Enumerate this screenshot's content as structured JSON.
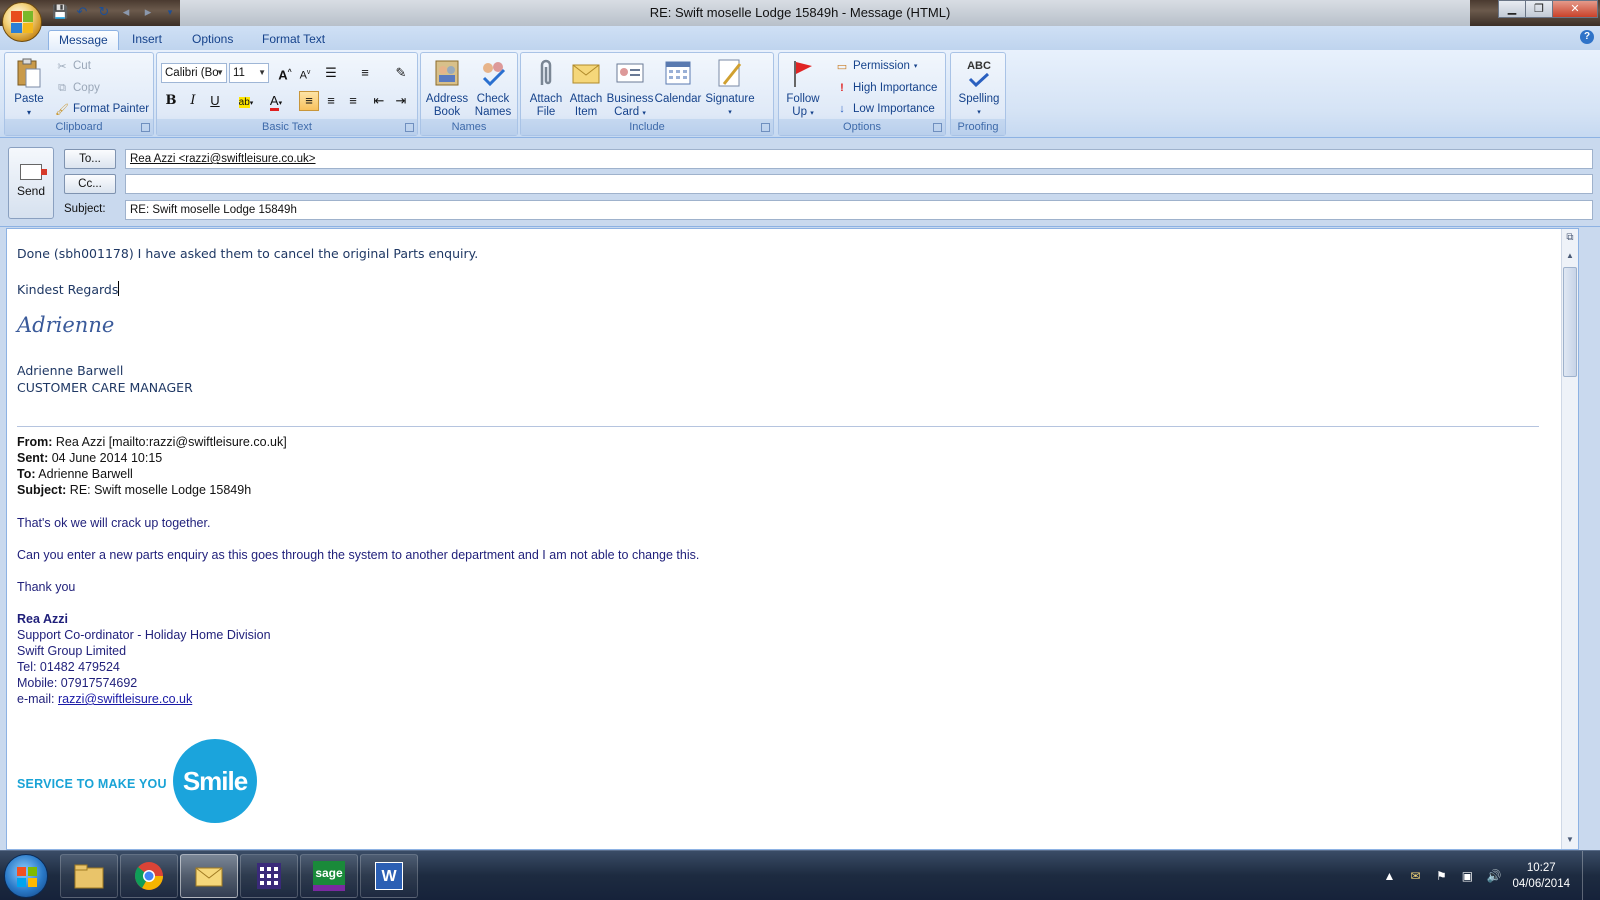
{
  "window": {
    "title": "RE: Swift moselle Lodge 15849h - Message (HTML)",
    "minimize": "▁",
    "maximize": "❐",
    "close": "✕"
  },
  "quick_access": [
    "save-icon",
    "undo-icon",
    "redo-icon",
    "back-icon",
    "forward-icon",
    "customize-icon"
  ],
  "tabs": [
    "Message",
    "Insert",
    "Options",
    "Format Text"
  ],
  "ribbon": {
    "clipboard": {
      "label": "Clipboard",
      "paste": "Paste",
      "cut": "Cut",
      "copy": "Copy",
      "format_painter": "Format Painter"
    },
    "basic_text": {
      "label": "Basic Text",
      "font": "Calibri (Bo",
      "size": "11",
      "grow": "A",
      "shrink": "A",
      "bold": "B",
      "italic": "I",
      "underline": "U"
    },
    "names": {
      "label": "Names",
      "address_book": "Address\nBook",
      "address_book_l1": "Address",
      "address_book_l2": "Book",
      "check_l1": "Check",
      "check_l2": "Names"
    },
    "include": {
      "label": "Include",
      "attach_file_l1": "Attach",
      "attach_file_l2": "File",
      "attach_item_l1": "Attach",
      "attach_item_l2": "Item",
      "business_card_l1": "Business",
      "business_card_l2": "Card",
      "calendar": "Calendar",
      "signature": "Signature"
    },
    "follow_up": {
      "l1": "Follow",
      "l2": "Up"
    },
    "options": {
      "label": "Options",
      "permission": "Permission",
      "high": "High Importance",
      "low": "Low Importance"
    },
    "proofing": {
      "label": "Proofing",
      "spelling": "Spelling",
      "abc": "ABC"
    }
  },
  "header": {
    "send": "Send",
    "to_button": "To...",
    "cc_button": "Cc...",
    "subject_label": "Subject:",
    "to_value": "Rea Azzi <razzi@swiftleisure.co.uk>",
    "cc_value": "",
    "subject_value": "RE: Swift moselle Lodge 15849h"
  },
  "body": {
    "reply_line": "Done (sbh001178) I have asked them to cancel the original Parts enquiry.",
    "regards": "Kindest Regards",
    "script_signature": "Adrienne",
    "sender_name": "Adrienne Barwell",
    "sender_title": "CUSTOMER CARE MANAGER",
    "quoted": {
      "from_label": "From:",
      "from_value": " Rea Azzi [mailto:razzi@swiftleisure.co.uk]",
      "sent_label": "Sent:",
      "sent_value": " 04 June 2014 10:15",
      "to_label": "To:",
      "to_value": " Adrienne Barwell",
      "subject_label": "Subject:",
      "subject_value": " RE: Swift moselle Lodge 15849h"
    },
    "msg1": "That's ok we will crack up together.",
    "msg2": "Can you enter a new parts enquiry as this goes through the system to another department and I am not able to change this.",
    "msg3": "Thank you",
    "sig": {
      "name": "Rea Azzi",
      "role": "Support Co-ordinator - Holiday Home Division",
      "company": "Swift Group Limited",
      "tel": "Tel: 01482 479524",
      "mobile": "Mobile: 07917574692",
      "email_label": "e-mail: ",
      "email": "razzi@swiftleisure.co.uk"
    },
    "banner_text": "SERVICE TO MAKE YOU",
    "banner_smile": "Smile"
  },
  "taskbar": {
    "apps": [
      "windows-explorer",
      "chrome",
      "outlook",
      "calculator-app",
      "sage",
      "word"
    ],
    "time": "10:27",
    "date": "04/06/2014"
  },
  "colors": {
    "ribbon_blue": "#15428b",
    "body_text": "#1f3864",
    "banner_blue": "#1ba4dc"
  }
}
